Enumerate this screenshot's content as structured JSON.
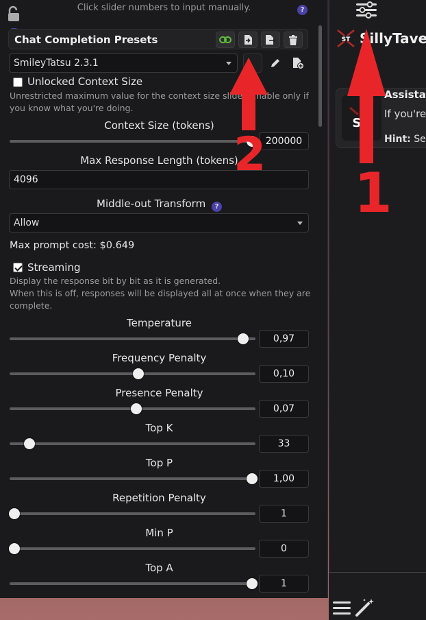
{
  "top_hint": "Click slider numbers to input manually.",
  "presets": {
    "title": "Chat Completion Presets",
    "selected": "SmileyTatsu 2.3.1"
  },
  "unlocked_context": {
    "label": "Unlocked Context Size",
    "description_line1": "Unrestricted maximum value for the context size slider. Enable only if",
    "description_line2": "you know what you're doing."
  },
  "context_size": {
    "label": "Context Size (tokens)",
    "value": "200000",
    "fraction": 0.985
  },
  "max_response": {
    "label": "Max Response Length (tokens)",
    "value": "4096"
  },
  "middle_out": {
    "label": "Middle-out Transform",
    "value": "Allow"
  },
  "max_prompt_cost": "Max prompt cost: $0.649",
  "streaming": {
    "label": "Streaming",
    "desc1": "Display the response bit by bit as it is generated.",
    "desc2": "When this is off, responses will be displayed all at once when they are",
    "desc3": "complete."
  },
  "sliders": [
    {
      "label": "Temperature",
      "value": "0,97",
      "fraction": 0.95
    },
    {
      "label": "Frequency Penalty",
      "value": "0,10",
      "fraction": 0.525
    },
    {
      "label": "Presence Penalty",
      "value": "0,07",
      "fraction": 0.515
    },
    {
      "label": "Top K",
      "value": "33",
      "fraction": 0.08
    },
    {
      "label": "Top P",
      "value": "1,00",
      "fraction": 0.985
    },
    {
      "label": "Repetition Penalty",
      "value": "1",
      "fraction": 0.02
    },
    {
      "label": "Min P",
      "value": "0",
      "fraction": 0.02
    },
    {
      "label": "Top A",
      "value": "1",
      "fraction": 0.985
    }
  ],
  "right": {
    "app_name": "SillyTavern",
    "card_title": "Assistant",
    "card_line1": "If you're",
    "card_hint_label": "Hint:",
    "card_hint_text": "Set"
  },
  "annotations": {
    "one": "1",
    "two": "2"
  },
  "colors": {
    "accent_purple": "#4a42a8",
    "annotation_red": "#e8262a",
    "link_green": "#5fbf3a"
  }
}
